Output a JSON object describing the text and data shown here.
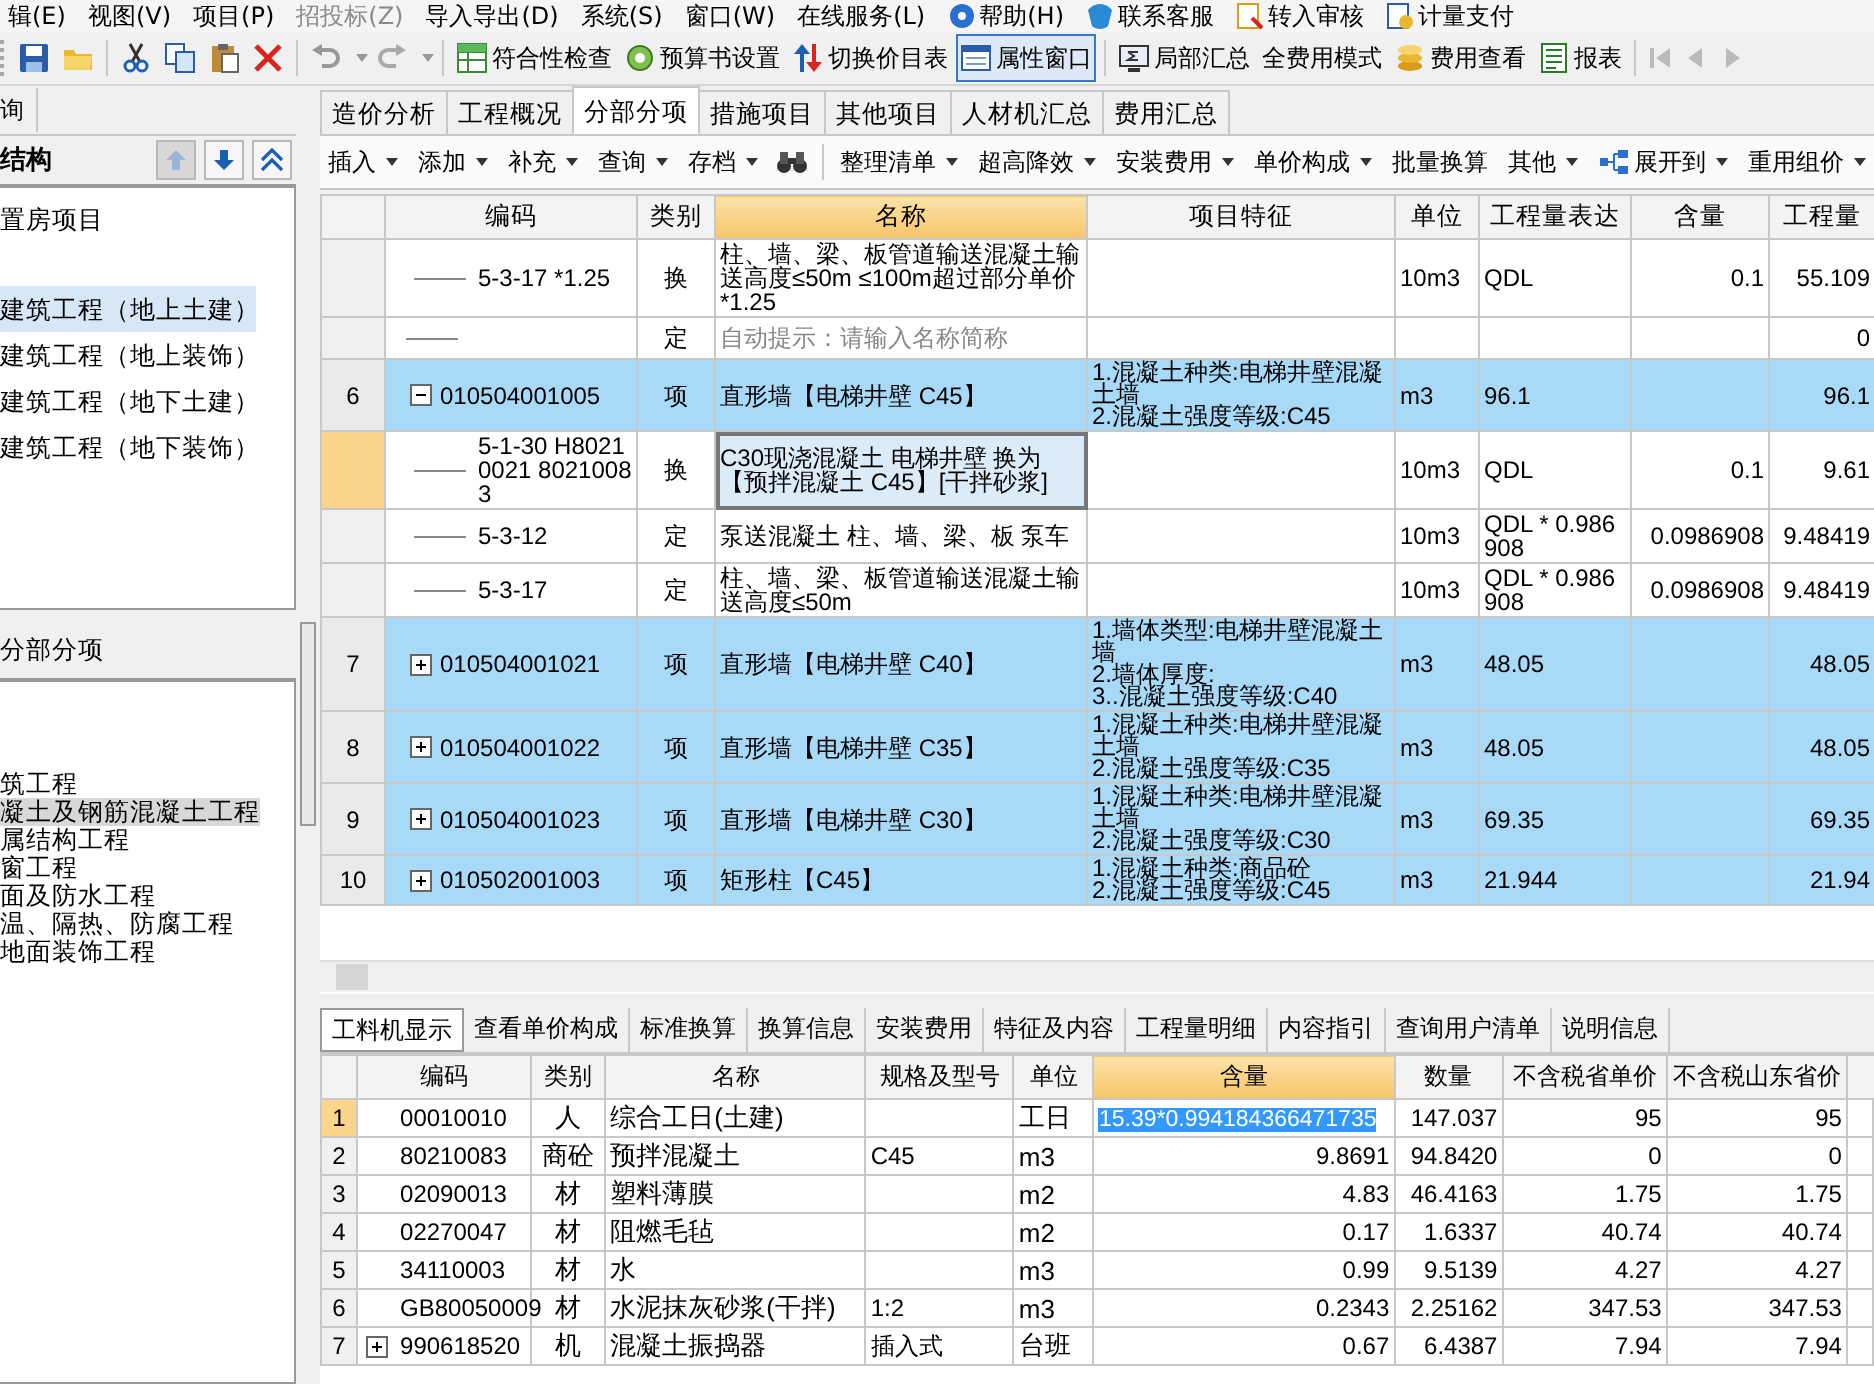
{
  "menu_bar": [
    {
      "kind": "plain",
      "label": "辑(E)",
      "disabled": false
    },
    {
      "kind": "plain",
      "label": "视图(V)",
      "disabled": false
    },
    {
      "kind": "plain",
      "label": "项目(P)",
      "disabled": false
    },
    {
      "kind": "plain",
      "label": "招投标(Z)",
      "disabled": true
    },
    {
      "kind": "plain",
      "label": "导入导出(D)",
      "disabled": false
    },
    {
      "kind": "plain",
      "label": "系统(S)",
      "disabled": false
    },
    {
      "kind": "plain",
      "label": "窗口(W)",
      "disabled": false
    },
    {
      "kind": "plain",
      "label": "在线服务(L)",
      "disabled": false
    },
    {
      "kind": "iconic",
      "label": "帮助(H)",
      "disabled": false
    },
    {
      "kind": "iconic",
      "label": "联系客服",
      "disabled": false
    },
    {
      "kind": "iconic",
      "label": "转入审核",
      "disabled": false
    },
    {
      "kind": "iconic",
      "label": "计量支付",
      "disabled": false
    }
  ],
  "toolbar_buttons": [
    {
      "label": "符合性检查",
      "pressed": false
    },
    {
      "label": "预算书设置",
      "pressed": false
    },
    {
      "label": "切换价目表",
      "pressed": false
    },
    {
      "label": "属性窗口",
      "pressed": true
    },
    {
      "label": "局部汇总",
      "pressed": false
    },
    {
      "label": "全费用模式",
      "pressed": false
    },
    {
      "label": "费用查看",
      "pressed": false
    },
    {
      "label": "报表",
      "pressed": false
    }
  ],
  "left_panel": {
    "tab": "询",
    "structure": {
      "title": "结构",
      "items": [
        {
          "label": "置房项目",
          "selected": false
        },
        {
          "label": "建筑工程（地上土建）",
          "selected": true
        },
        {
          "label": "建筑工程（地上装饰）",
          "selected": false
        },
        {
          "label": "建筑工程（地下土建）",
          "selected": false
        },
        {
          "label": "建筑工程（地下装饰）",
          "selected": false
        }
      ]
    },
    "division": {
      "title": "分部分项",
      "items": [
        {
          "label": "筑工程",
          "selected": false
        },
        {
          "label": "凝土及钢筋混凝土工程",
          "selected": true
        },
        {
          "label": "属结构工程",
          "selected": false
        },
        {
          "label": "窗工程",
          "selected": false
        },
        {
          "label": "面及防水工程",
          "selected": false
        },
        {
          "label": "温、隔热、防腐工程",
          "selected": false
        },
        {
          "label": "地面装饰工程",
          "selected": false
        }
      ]
    }
  },
  "tabs": [
    {
      "label": "造价分析",
      "selected": false
    },
    {
      "label": "工程概况",
      "selected": false
    },
    {
      "label": "分部分项",
      "selected": true
    },
    {
      "label": "措施项目",
      "selected": false
    },
    {
      "label": "其他项目",
      "selected": false
    },
    {
      "label": "人材机汇总",
      "selected": false
    },
    {
      "label": "费用汇总",
      "selected": false
    }
  ],
  "sub_toolbar": [
    {
      "kind": "menu",
      "label": "插入"
    },
    {
      "kind": "menu",
      "label": "添加"
    },
    {
      "kind": "menu",
      "label": "补充"
    },
    {
      "kind": "menu",
      "label": "查询"
    },
    {
      "kind": "menu",
      "label": "存档"
    },
    {
      "kind": "icon"
    },
    {
      "kind": "menu",
      "label": "整理清单"
    },
    {
      "kind": "menu",
      "label": "超高降效"
    },
    {
      "kind": "menu",
      "label": "安装费用"
    },
    {
      "kind": "menu",
      "label": "单价构成"
    },
    {
      "kind": "button",
      "label": "批量换算"
    },
    {
      "kind": "menu",
      "label": "其他"
    },
    {
      "kind": "iconmenu",
      "label": "展开到"
    },
    {
      "kind": "menu",
      "label": "重用组价"
    }
  ],
  "grid": {
    "columns": [
      {
        "label": "编码",
        "selected": false
      },
      {
        "label": "类别",
        "selected": false
      },
      {
        "label": "名称",
        "selected": true
      },
      {
        "label": "项目特征",
        "selected": false
      },
      {
        "label": "单位",
        "selected": false
      },
      {
        "label": "工程量表达",
        "selected": false
      },
      {
        "label": "含量",
        "selected": false
      },
      {
        "label": "工程量",
        "selected": false
      }
    ],
    "rows": [
      {
        "kind": "quota",
        "selected": false,
        "code": "5-3-17 *1.25",
        "type": "换",
        "name": "柱、墙、梁、板管道输送混凝土输送高度≤50m ≤100m超过部分单价*1.25",
        "unit": "10m3",
        "expression": "QDL",
        "content": "0.1",
        "quantity": "55.109"
      },
      {
        "kind": "hint",
        "selected": false,
        "type": "定",
        "name": "自动提示：请输入名称简称",
        "quantity": "0"
      },
      {
        "kind": "bill",
        "selected": false,
        "number": "6",
        "expanded": true,
        "code": "010504001005",
        "type": "项",
        "name": "直形墙【电梯井壁 C45】",
        "features": "1.混凝土种类:电梯井壁混凝土墙\n2.混凝土强度等级:C45",
        "unit": "m3",
        "expression": "96.1",
        "quantity": "96.1"
      },
      {
        "kind": "quota",
        "selected": true,
        "code": "5-1-30 H80210021 80210083",
        "type": "换",
        "name": "C30现浇混凝土 电梯井壁 换为【预拌混凝土 C45】[干拌砂浆]",
        "unit": "10m3",
        "expression": "QDL",
        "content": "0.1",
        "quantity": "9.61"
      },
      {
        "kind": "quota",
        "selected": false,
        "code": "5-3-12",
        "type": "定",
        "name": "泵送混凝土 柱、墙、梁、板 泵车",
        "unit": "10m3",
        "expression": "QDL * 0.986908",
        "content": "0.0986908",
        "quantity": "9.48419"
      },
      {
        "kind": "quota",
        "selected": false,
        "code": "5-3-17",
        "type": "定",
        "name": "柱、墙、梁、板管道输送混凝土输送高度≤50m",
        "unit": "10m3",
        "expression": "QDL * 0.986908",
        "content": "0.0986908",
        "quantity": "9.48419"
      },
      {
        "kind": "bill",
        "selected": false,
        "number": "7",
        "expanded": false,
        "code": "010504001021",
        "type": "项",
        "name": "直形墙【电梯井壁 C40】",
        "features": "1.墙体类型:电梯井壁混凝土墙\n2.墙体厚度:\n3..混凝土强度等级:C40",
        "unit": "m3",
        "expression": "48.05",
        "quantity": "48.05"
      },
      {
        "kind": "bill",
        "selected": false,
        "number": "8",
        "expanded": false,
        "code": "010504001022",
        "type": "项",
        "name": "直形墙【电梯井壁 C35】",
        "features": "1.混凝土种类:电梯井壁混凝土墙\n2.混凝土强度等级:C35",
        "unit": "m3",
        "expression": "48.05",
        "quantity": "48.05"
      },
      {
        "kind": "bill",
        "selected": false,
        "number": "9",
        "expanded": false,
        "code": "010504001023",
        "type": "项",
        "name": "直形墙【电梯井壁 C30】",
        "features": "1.混凝土种类:电梯井壁混凝土墙\n2.混凝土强度等级:C30",
        "unit": "m3",
        "expression": "69.35",
        "quantity": "69.35"
      },
      {
        "kind": "bill",
        "selected": false,
        "number": "10",
        "expanded": false,
        "code": "010502001003",
        "type": "项",
        "name": "矩形柱【C45】",
        "features": "1.混凝土种类:商品砼\n2.混凝土强度等级:C45",
        "unit": "m3",
        "expression": "21.944",
        "quantity": "21.94"
      }
    ]
  },
  "lower_tabs": [
    {
      "label": "工料机显示",
      "selected": true
    },
    {
      "label": "查看单价构成",
      "selected": false
    },
    {
      "label": "标准换算",
      "selected": false
    },
    {
      "label": "换算信息",
      "selected": false
    },
    {
      "label": "安装费用",
      "selected": false
    },
    {
      "label": "特征及内容",
      "selected": false
    },
    {
      "label": "工程量明细",
      "selected": false
    },
    {
      "label": "内容指引",
      "selected": false
    },
    {
      "label": "查询用户清单",
      "selected": false
    },
    {
      "label": "说明信息",
      "selected": false
    }
  ],
  "resources": {
    "columns": [
      {
        "label": "编码",
        "selected": false
      },
      {
        "label": "类别",
        "selected": false
      },
      {
        "label": "名称",
        "selected": false
      },
      {
        "label": "规格及型号",
        "selected": false
      },
      {
        "label": "单位",
        "selected": false
      },
      {
        "label": "含量",
        "selected": true
      },
      {
        "label": "数量",
        "selected": false
      },
      {
        "label": "不含税省单价",
        "selected": false
      },
      {
        "label": "不含税山东省价",
        "selected": false
      }
    ],
    "rows": [
      {
        "number": "1",
        "selected": true,
        "kind": "item",
        "code": "00010010",
        "type": "人",
        "name": "综合工日(土建)",
        "unit": "工日",
        "content": "15.39*0.994184366471735",
        "amount": "147.037",
        "price": "95",
        "sd_price": "95"
      },
      {
        "number": "2",
        "selected": false,
        "kind": "item",
        "code": "80210083",
        "type": "商砼",
        "name": "预拌混凝土",
        "spec": "C45",
        "unit": "m3",
        "content": "9.8691",
        "amount": "94.8420",
        "price": "0",
        "sd_price": "0"
      },
      {
        "number": "3",
        "selected": false,
        "kind": "item",
        "code": "02090013",
        "type": "材",
        "name": "塑料薄膜",
        "unit": "m2",
        "content": "4.83",
        "amount": "46.4163",
        "price": "1.75",
        "sd_price": "1.75"
      },
      {
        "number": "4",
        "selected": false,
        "kind": "item",
        "code": "02270047",
        "type": "材",
        "name": "阻燃毛毡",
        "unit": "m2",
        "content": "0.17",
        "amount": "1.6337",
        "price": "40.74",
        "sd_price": "40.74"
      },
      {
        "number": "5",
        "selected": false,
        "kind": "item",
        "code": "34110003",
        "type": "材",
        "name": "水",
        "unit": "m3",
        "content": "0.99",
        "amount": "9.5139",
        "price": "4.27",
        "sd_price": "4.27"
      },
      {
        "number": "6",
        "selected": false,
        "kind": "item",
        "code": "GB80050009",
        "type": "材",
        "name": "水泥抹灰砂浆(干拌)",
        "spec": "1:2",
        "unit": "m3",
        "content": "0.2343",
        "amount": "2.25162",
        "price": "347.53",
        "sd_price": "347.53"
      },
      {
        "number": "7",
        "selected": false,
        "kind": "group",
        "code": "990618520",
        "type": "机",
        "name": "混凝土振捣器",
        "spec": "插入式",
        "unit": "台班",
        "content": "0.67",
        "amount": "6.4387",
        "price": "7.94",
        "sd_price": "7.94"
      }
    ]
  }
}
